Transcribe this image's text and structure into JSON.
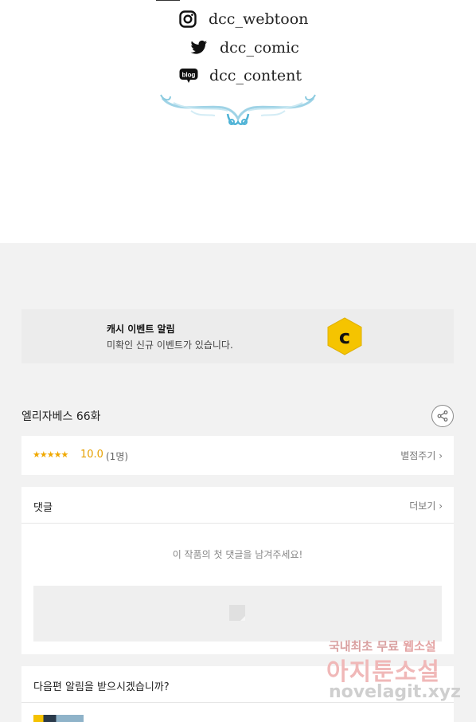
{
  "social": {
    "instagram": "dcc_webtoon",
    "twitter": "dcc_comic",
    "blog": "dcc_content",
    "blog_badge": "blog"
  },
  "event": {
    "title": "캐시 이벤트 알림",
    "desc": "미확인 신규 이벤트가 있습니다.",
    "logo_letter": "c",
    "logo_color": "#f5c400"
  },
  "episode": {
    "title": "엘리자베스 66화"
  },
  "rating": {
    "stars": "★★★★★",
    "score": "10.0",
    "count": "(1명)",
    "rate_link": "별점주기 ›"
  },
  "comments": {
    "heading": "댓글",
    "more": "더보기 ›",
    "empty_text": "이 작품의 첫 댓글을 남겨주세요!"
  },
  "notify": {
    "question": "다음편 알림을 받으시겠습니까?"
  },
  "watermark": {
    "line1_a": "국내최초 무료",
    "line1_b": "웹소설",
    "line2": "아지툰소설",
    "line3": "novelagit.xyz"
  }
}
